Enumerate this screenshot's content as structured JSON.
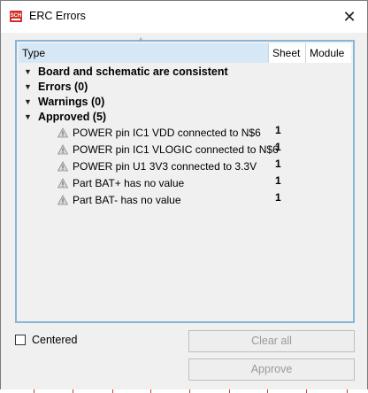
{
  "window": {
    "title": "ERC Errors",
    "app_icon": "SCH",
    "close": "✕"
  },
  "table": {
    "columns": {
      "type": "Type",
      "sheet": "Sheet",
      "module": "Module"
    },
    "groups": [
      {
        "label": "Board and schematic are consistent"
      },
      {
        "label": "Errors (0)"
      },
      {
        "label": "Warnings (0)"
      },
      {
        "label": "Approved (5)"
      }
    ],
    "items": [
      {
        "label": "POWER pin IC1 VDD connected to N$6",
        "sheet": "1"
      },
      {
        "label": "POWER pin IC1 VLOGIC connected to N$6",
        "sheet": "1"
      },
      {
        "label": "POWER pin U1 3V3 connected to 3.3V",
        "sheet": "1"
      },
      {
        "label": "Part BAT+ has no value",
        "sheet": "1"
      },
      {
        "label": "Part BAT- has no value",
        "sheet": "1"
      }
    ]
  },
  "footer": {
    "centered_label": "Centered",
    "centered_checked": false,
    "clear_all_label": "Clear all",
    "approve_label": "Approve"
  },
  "colors": {
    "panel_border": "#87b6d9",
    "header_bg": "#d6e8f6",
    "app_icon_red": "#d42b2b",
    "warning_gray": "#8a8a8a"
  }
}
